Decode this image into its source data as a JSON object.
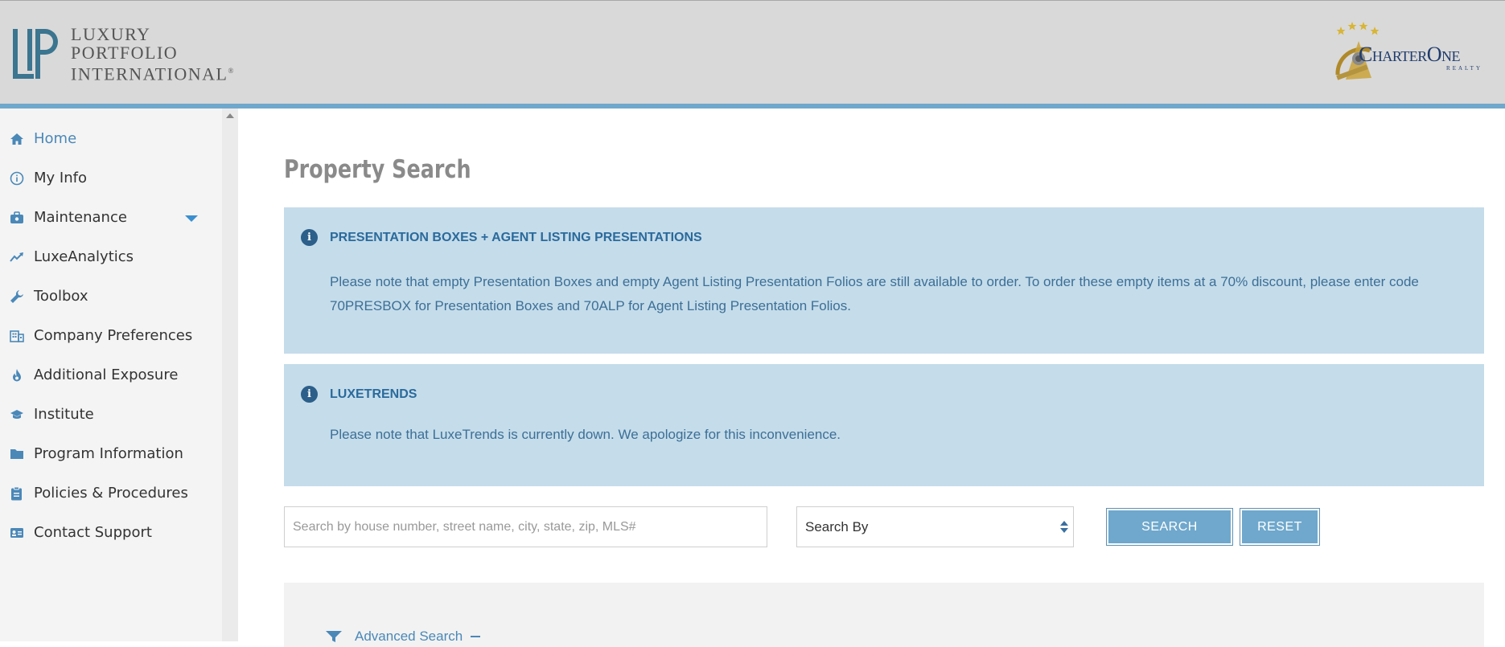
{
  "header": {
    "logo_lines": [
      "LUXURY",
      "PORTFOLIO",
      "INTERNATIONAL"
    ],
    "logo_registered": "®",
    "partner_name": "CharterOne",
    "partner_sub": "REALTY"
  },
  "sidebar": {
    "items": [
      {
        "label": "Home",
        "icon": "home-icon",
        "active": true
      },
      {
        "label": "My Info",
        "icon": "info-circle-icon"
      },
      {
        "label": "Maintenance",
        "icon": "briefcase-icon",
        "has_dropdown": true
      },
      {
        "label": "LuxeAnalytics",
        "icon": "trend-chart-icon"
      },
      {
        "label": "Toolbox",
        "icon": "wrench-icon"
      },
      {
        "label": "Company Preferences",
        "icon": "building-icon"
      },
      {
        "label": "Additional Exposure",
        "icon": "flame-icon"
      },
      {
        "label": "Institute",
        "icon": "graduation-cap-icon"
      },
      {
        "label": "Program Information",
        "icon": "folder-icon"
      },
      {
        "label": "Policies & Procedures",
        "icon": "clipboard-icon"
      },
      {
        "label": "Contact Support",
        "icon": "id-card-icon"
      }
    ]
  },
  "main": {
    "title": "Property Search",
    "alerts": [
      {
        "title": "PRESENTATION BOXES + AGENT LISTING PRESENTATIONS",
        "body": "Please note that empty Presentation Boxes and empty Agent Listing Presentation Folios are still available to order. To order these empty items at a 70% discount, please enter code 70PRESBOX for Presentation Boxes and 70ALP for Agent Listing Presentation Folios."
      },
      {
        "title": "LUXETRENDS",
        "body": "Please note that LuxeTrends is currently down. We apologize for this inconvenience."
      }
    ],
    "search": {
      "placeholder": "Search by house number, street name, city, state, zip, MLS#",
      "value": "",
      "search_by": "Search By",
      "search_label": "SEARCH",
      "reset_label": "RESET"
    },
    "advanced": {
      "label": "Advanced Search"
    }
  },
  "colors": {
    "accent": "#6fa8cc",
    "alert_bg": "#c5dcea",
    "alert_text": "#3c6f97",
    "header_bg": "#d9d9d9"
  }
}
